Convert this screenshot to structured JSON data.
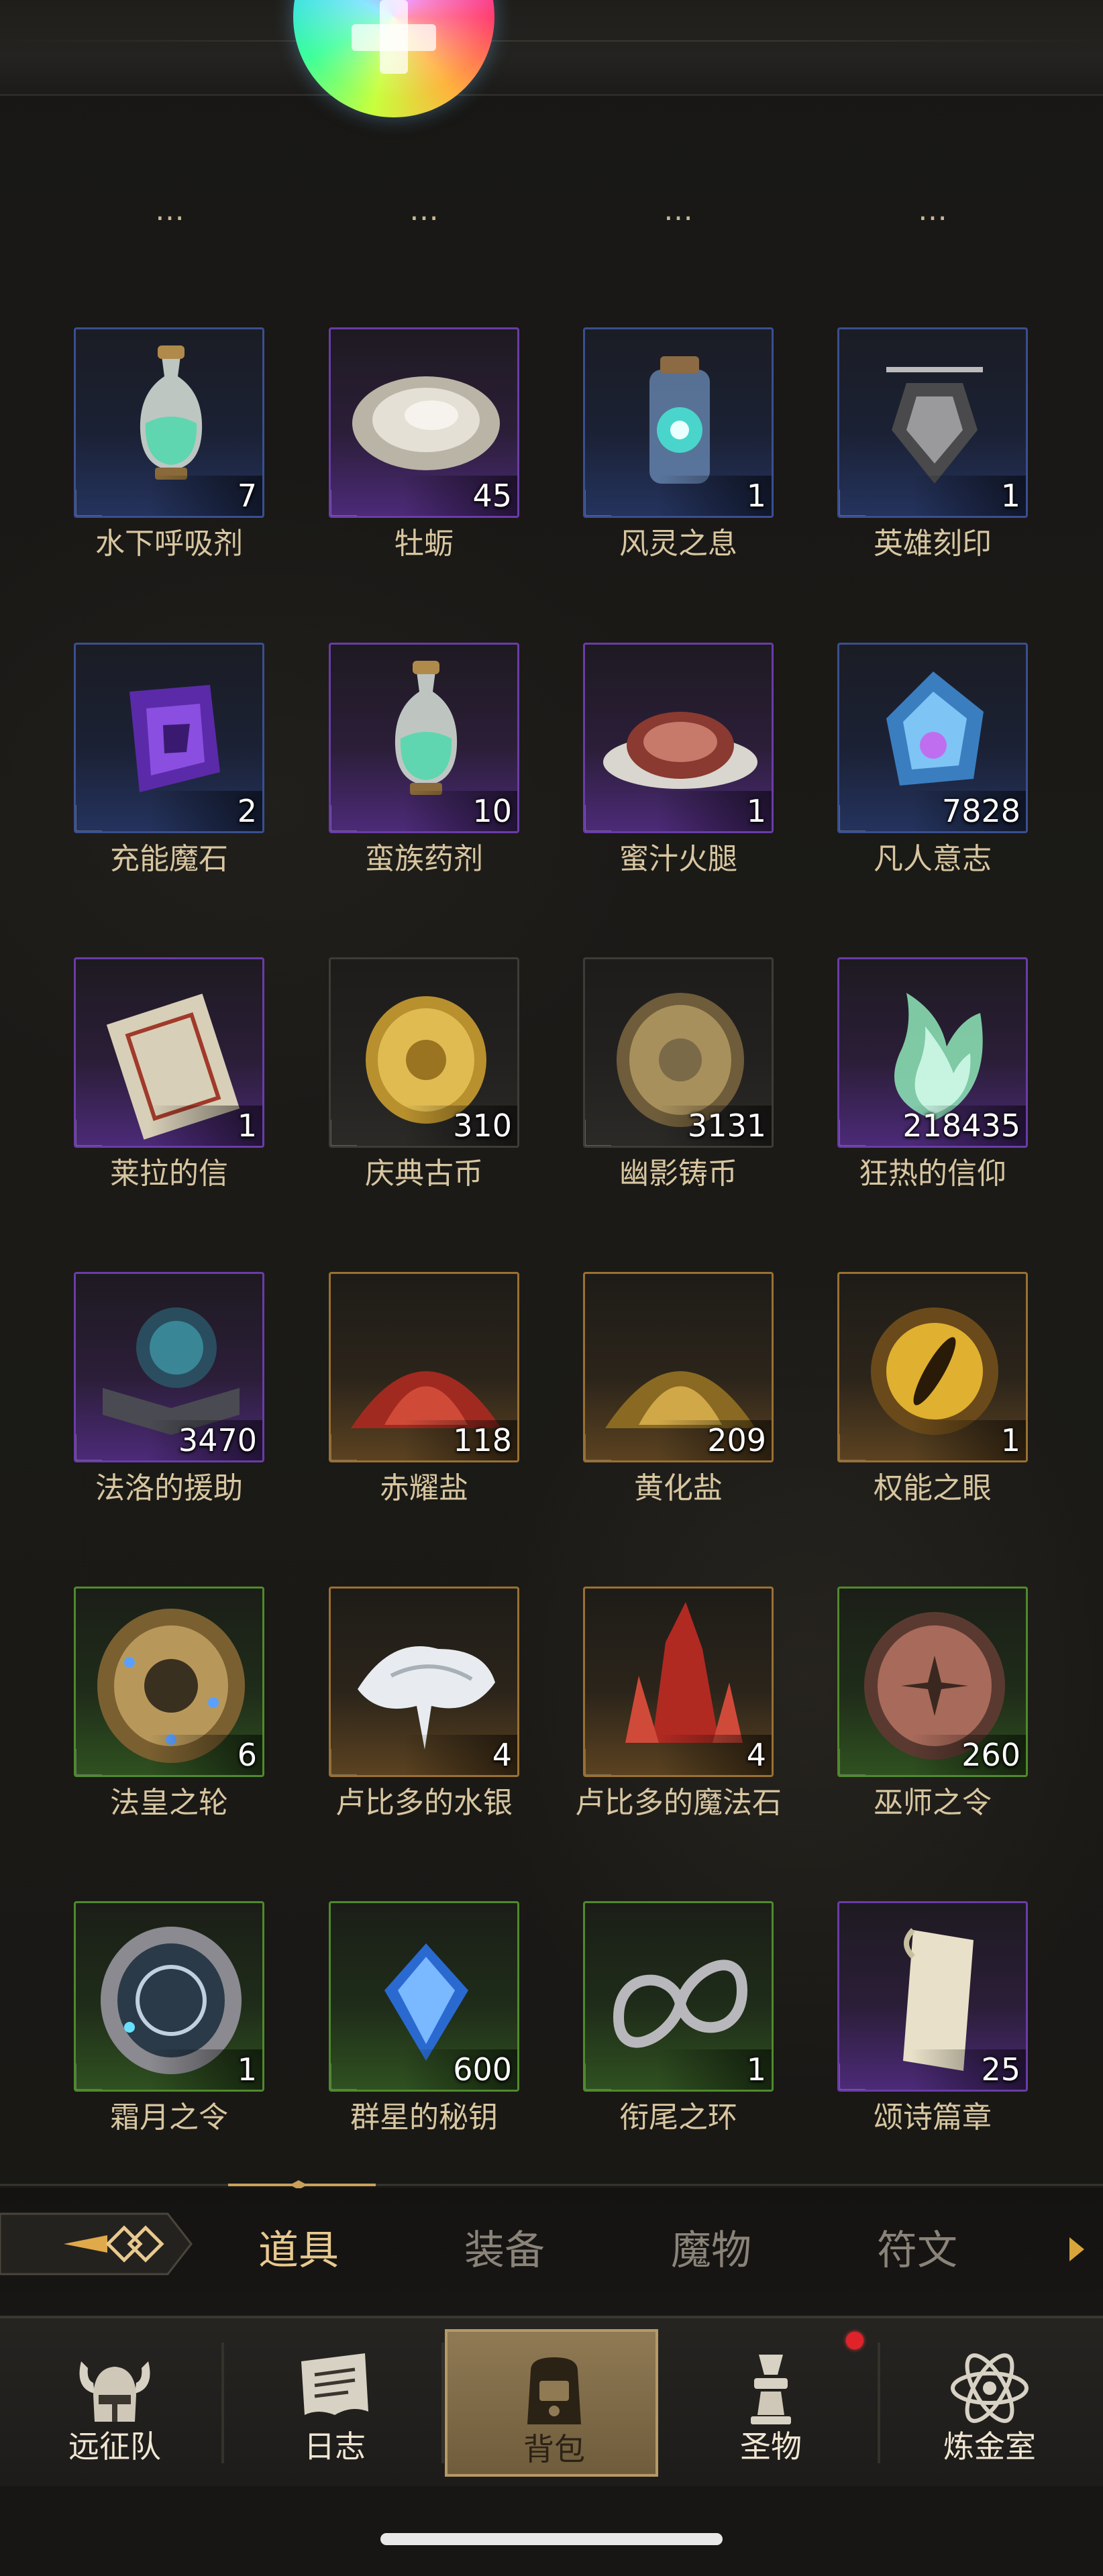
{
  "cutoff_row": [
    "…",
    "…",
    "…",
    "…"
  ],
  "items": [
    {
      "name": "水下呼吸剂",
      "count": "7",
      "rarity": "blue",
      "icon": "potion-icon"
    },
    {
      "name": "牡蛎",
      "count": "45",
      "rarity": "purple",
      "icon": "oyster-icon"
    },
    {
      "name": "风灵之息",
      "count": "1",
      "rarity": "blue",
      "icon": "bottle-icon"
    },
    {
      "name": "英雄刻印",
      "count": "1",
      "rarity": "blue",
      "icon": "seal-icon"
    },
    {
      "name": "充能魔石",
      "count": "2",
      "rarity": "blue",
      "icon": "magic-stone-icon"
    },
    {
      "name": "蛮族药剂",
      "count": "10",
      "rarity": "purple",
      "icon": "potion-icon"
    },
    {
      "name": "蜜汁火腿",
      "count": "1",
      "rarity": "purple",
      "icon": "ham-icon"
    },
    {
      "name": "凡人意志",
      "count": "7828",
      "rarity": "blue",
      "icon": "crystal-icon"
    },
    {
      "name": "莱拉的信",
      "count": "1",
      "rarity": "purple",
      "icon": "letter-icon"
    },
    {
      "name": "庆典古币",
      "count": "310",
      "rarity": "gray",
      "icon": "gold-coin-icon"
    },
    {
      "name": "幽影铸币",
      "count": "3131",
      "rarity": "gray",
      "icon": "bronze-coin-icon"
    },
    {
      "name": "狂热的信仰",
      "count": "218435",
      "rarity": "purple",
      "icon": "flame-icon"
    },
    {
      "name": "法洛的援助",
      "count": "3470",
      "rarity": "purple",
      "icon": "book-icon"
    },
    {
      "name": "赤耀盐",
      "count": "118",
      "rarity": "gold",
      "icon": "red-salt-icon"
    },
    {
      "name": "黄化盐",
      "count": "209",
      "rarity": "gold",
      "icon": "yellow-salt-icon"
    },
    {
      "name": "权能之眼",
      "count": "1",
      "rarity": "gold",
      "icon": "eye-icon"
    },
    {
      "name": "法皇之轮",
      "count": "6",
      "rarity": "green",
      "icon": "wheel-icon"
    },
    {
      "name": "卢比多的水银",
      "count": "4",
      "rarity": "gold",
      "icon": "mercury-icon"
    },
    {
      "name": "卢比多的魔法石",
      "count": "4",
      "rarity": "gold",
      "icon": "red-crystal-icon"
    },
    {
      "name": "巫师之令",
      "count": "260",
      "rarity": "green",
      "icon": "medal-icon"
    },
    {
      "name": "霜月之令",
      "count": "1",
      "rarity": "green",
      "icon": "silver-medal-icon"
    },
    {
      "name": "群星的秘钥",
      "count": "600",
      "rarity": "green",
      "icon": "blue-gem-icon"
    },
    {
      "name": "衔尾之环",
      "count": "1",
      "rarity": "green",
      "icon": "ouroboros-icon"
    },
    {
      "name": "颂诗篇章",
      "count": "25",
      "rarity": "purple",
      "icon": "scroll-icon"
    }
  ],
  "tabs": [
    "道具",
    "装备",
    "魔物",
    "符文"
  ],
  "active_tab": "道具",
  "nav": [
    {
      "label": "远征队",
      "icon": "viking-helmet-icon"
    },
    {
      "label": "日志",
      "icon": "journal-icon"
    },
    {
      "label": "背包",
      "icon": "backpack-icon"
    },
    {
      "label": "圣物",
      "icon": "relic-icon"
    },
    {
      "label": "炼金室",
      "icon": "alchemy-icon"
    }
  ],
  "active_nav": "背包",
  "colors": {
    "accent_gold": "#e8c98f",
    "label": "#d8c6a0",
    "badge": "#e0232b",
    "blue": "#3a4f8f",
    "purple": "#6a3ca8",
    "gold": "#9a7032",
    "green": "#4f8a2c"
  }
}
